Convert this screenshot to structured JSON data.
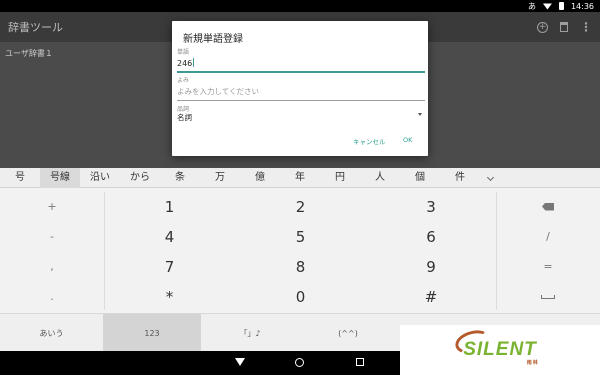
{
  "status": {
    "ime": "あ",
    "time": "14:36"
  },
  "app": {
    "title": "辞書ツール",
    "list_item": "ユーザ辞書１",
    "add_icon": "add-circle-icon",
    "delete_icon": "trash-icon",
    "menu_icon": "more-vert-icon"
  },
  "dialog": {
    "title": "新規単語登録",
    "word_label": "単語",
    "word_value": "246",
    "reading_label": "よみ",
    "reading_placeholder": "よみを入力してください",
    "pos_label": "品詞",
    "pos_value": "名詞",
    "cancel": "キャンセル",
    "ok": "OK"
  },
  "suggestions": [
    "号",
    "号線",
    "沿い",
    "から",
    "条",
    "万",
    "億",
    "年",
    "円",
    "人",
    "個",
    "件"
  ],
  "suggestion_selected_index": 1,
  "keypad": {
    "rows": [
      {
        "left": "+",
        "nums": [
          "1",
          "2",
          "3"
        ],
        "right_icon": "backspace-icon"
      },
      {
        "left": "-",
        "nums": [
          "4",
          "5",
          "6"
        ],
        "right": "/"
      },
      {
        "left": ",",
        "nums": [
          "7",
          "8",
          "9"
        ],
        "right": "="
      },
      {
        "left": ".",
        "nums": [
          "*",
          "0",
          "#"
        ],
        "right_icon": "space-icon"
      }
    ]
  },
  "modes": [
    "あいう",
    "123",
    "「」♪",
    "(^^)"
  ],
  "mode_selected_index": 1,
  "watermark": {
    "text": "SILENT",
    "sub": "雨林"
  },
  "colors": {
    "accent": "#3e9a93",
    "button": "#2a9d8f",
    "logo_green": "#7ab331",
    "logo_ring": "#b45a2c"
  }
}
